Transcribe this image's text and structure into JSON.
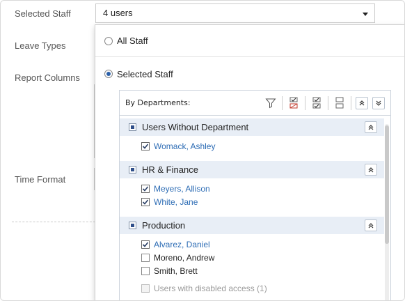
{
  "form": {
    "selected_staff_label": "Selected Staff",
    "leave_types_label": "Leave Types",
    "report_columns_label": "Report Columns",
    "time_format_label": "Time Format",
    "staff_select_value": "4 users"
  },
  "dropdown": {
    "all_staff_label": "All Staff",
    "selected_staff_label": "Selected Staff",
    "panel_title": "By Departments:",
    "tools": [
      "filter-icon",
      "select-filtered-icon",
      "check-all-icon",
      "uncheck-all-icon",
      "expand-all-icon",
      "collapse-all-icon"
    ],
    "groups": [
      {
        "name": "Users Without Department",
        "members": [
          {
            "name": "Womack, Ashley",
            "checked": true
          }
        ]
      },
      {
        "name": "HR & Finance",
        "members": [
          {
            "name": "Meyers, Allison",
            "checked": true
          },
          {
            "name": "White, Jane",
            "checked": true
          }
        ]
      },
      {
        "name": "Production",
        "members": [
          {
            "name": "Alvarez, Daniel",
            "checked": true
          },
          {
            "name": "Moreno, Andrew",
            "checked": false
          },
          {
            "name": "Smith, Brett",
            "checked": false
          }
        ],
        "disabled_label": "Users with disabled access (1)"
      }
    ]
  },
  "colors": {
    "link_blue": "#2e6db5",
    "group_bg": "#e8eef6",
    "radio_dot": "#2a5fa8"
  }
}
